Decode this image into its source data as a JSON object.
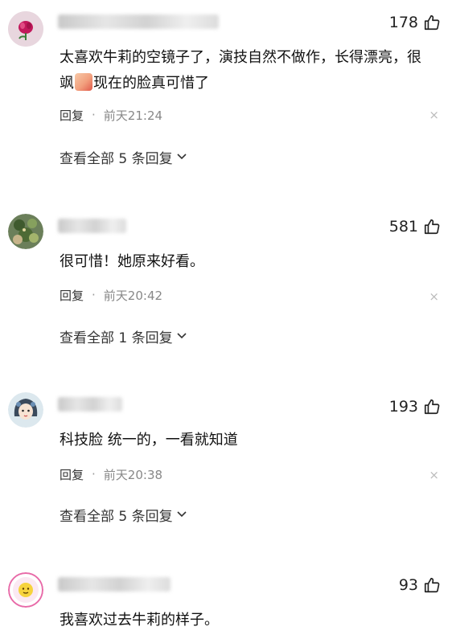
{
  "comments": [
    {
      "likes": "178",
      "text_before_emoji": "太喜欢牛莉的空镜子了，演技自然不做作，长得漂亮，很飒",
      "emoji": "thumbs-up-emoji",
      "text_after_emoji": "现在的脸真可惜了",
      "reply_label": "回复",
      "separator": "·",
      "time": "前天21:24",
      "close_glyph": "×",
      "view_all": "查看全部 5 条回复"
    },
    {
      "likes": "581",
      "text": "很可惜！她原来好看。",
      "reply_label": "回复",
      "separator": "·",
      "time": "前天20:42",
      "close_glyph": "×",
      "view_all": "查看全部 1 条回复"
    },
    {
      "likes": "193",
      "text": "科技脸 统一的，一看就知道",
      "reply_label": "回复",
      "separator": "·",
      "time": "前天20:38",
      "close_glyph": "×",
      "view_all": "查看全部 5 条回复"
    },
    {
      "likes": "93",
      "text": "我喜欢过去牛莉的样子。"
    }
  ],
  "icons": {
    "like": "thumbs-up-icon",
    "expand": "chevron-down-icon"
  },
  "colors": {
    "text": "#111111",
    "meta": "#888888",
    "background": "#ffffff"
  }
}
